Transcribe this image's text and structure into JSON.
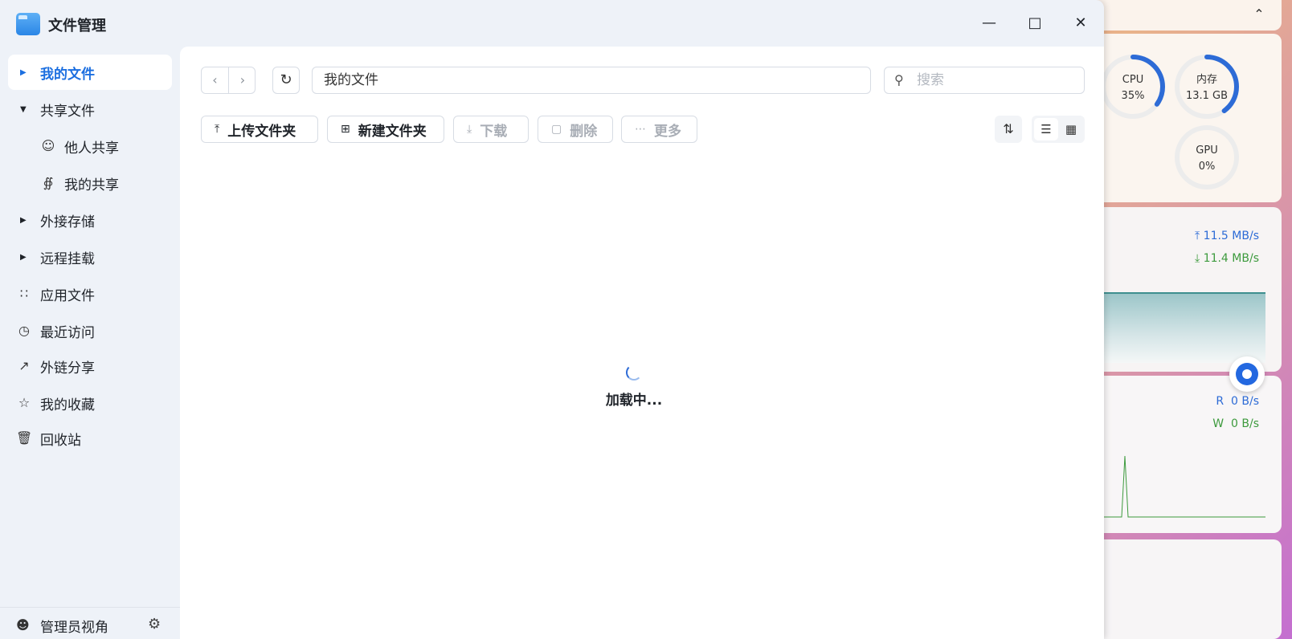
{
  "window": {
    "title": "文件管理"
  },
  "sidebar": {
    "items": [
      {
        "label": "我的文件"
      },
      {
        "label": "共享文件"
      },
      {
        "label": "他人共享"
      },
      {
        "label": "我的共享"
      },
      {
        "label": "外接存储"
      },
      {
        "label": "远程挂载"
      },
      {
        "label": "应用文件"
      },
      {
        "label": "最近访问"
      },
      {
        "label": "外链分享"
      },
      {
        "label": "我的收藏"
      },
      {
        "label": "回收站"
      }
    ],
    "footer": {
      "label": "管理员视角"
    }
  },
  "toolbar": {
    "path": "我的文件",
    "search_placeholder": "搜索",
    "upload_folder": "上传文件夹",
    "new_folder": "新建文件夹",
    "download": "下载",
    "delete": "删除",
    "more": "更多"
  },
  "content": {
    "loading_text": "加载中..."
  },
  "widgets": {
    "cpu": {
      "label": "CPU",
      "value": "35%",
      "percent": 35
    },
    "memory": {
      "label": "内存",
      "value": "13.1 GB",
      "percent": 40
    },
    "gpu": {
      "label": "GPU",
      "value": "0%",
      "percent": 0
    },
    "network": {
      "upload": "11.5 MB/s",
      "download": "11.4 MB/s"
    },
    "disk": {
      "read_label": "R",
      "read": "0 B/s",
      "write_label": "W",
      "write": "0 B/s"
    }
  },
  "colors": {
    "accent": "#1c6fe0",
    "ring_track": "#ececec",
    "ring_fill": "#2d6bd6",
    "upload_color": "#2d6bd6",
    "download_color": "#3d9a3d"
  }
}
